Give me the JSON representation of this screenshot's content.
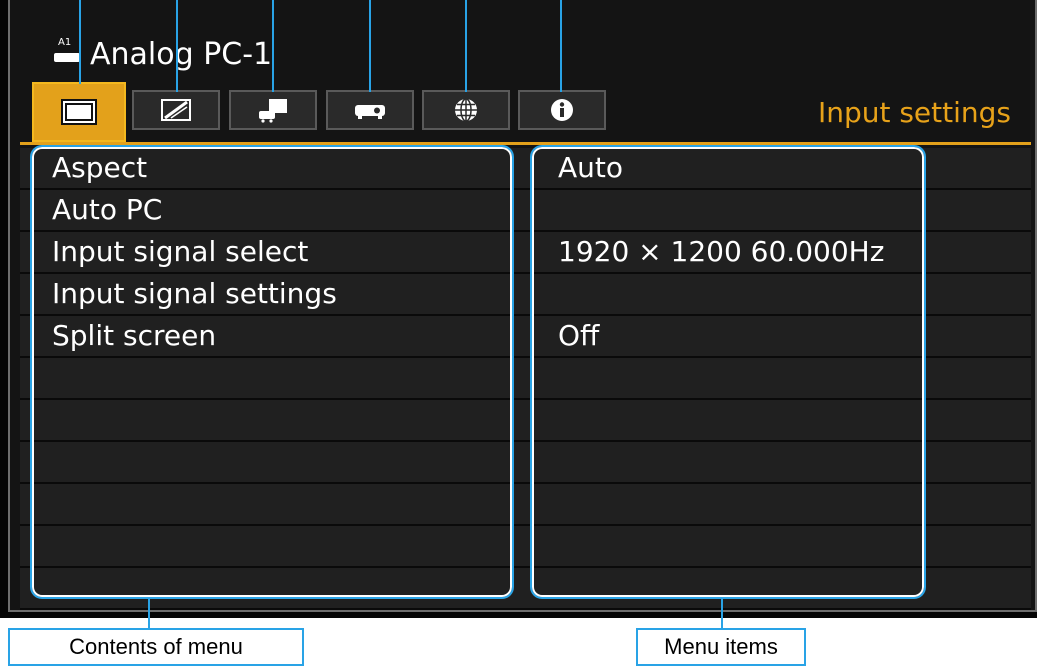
{
  "source": {
    "icon_label": "A1",
    "name": "Analog PC-1"
  },
  "tabs": [
    {
      "name": "image-adjustment",
      "icon": "monitor-icon",
      "active": true
    },
    {
      "name": "picture-adjustment",
      "icon": "image-adjust-icon",
      "active": false
    },
    {
      "name": "installation",
      "icon": "installation-icon",
      "active": false
    },
    {
      "name": "system",
      "icon": "projector-icon",
      "active": false
    },
    {
      "name": "network",
      "icon": "globe-icon",
      "active": false
    },
    {
      "name": "information",
      "icon": "info-icon",
      "active": false
    }
  ],
  "screen_title": "Input settings",
  "menu": {
    "rows": [
      {
        "label": "Aspect",
        "value": "Auto"
      },
      {
        "label": "Auto PC",
        "value": ""
      },
      {
        "label": "Input signal select",
        "value": "1920 × 1200 60.000Hz"
      },
      {
        "label": "Input signal settings",
        "value": ""
      },
      {
        "label": "Split screen",
        "value": "Off"
      },
      {
        "label": "",
        "value": ""
      },
      {
        "label": "",
        "value": ""
      },
      {
        "label": "",
        "value": ""
      },
      {
        "label": "",
        "value": ""
      },
      {
        "label": "",
        "value": ""
      },
      {
        "label": "",
        "value": ""
      }
    ]
  },
  "callouts": {
    "left": "Contents of menu",
    "right": "Menu items"
  },
  "colors": {
    "accent": "#e3a11b",
    "callout": "#29a3e6",
    "background": "#141414"
  }
}
